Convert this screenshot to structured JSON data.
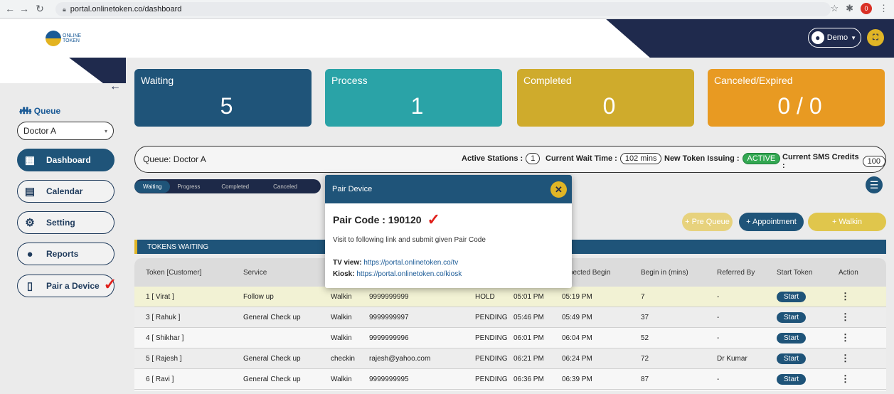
{
  "browser": {
    "url": "portal.onlinetoken.co/dashboard",
    "ext_badge": "0"
  },
  "header": {
    "logo_line1": "ONLINE",
    "logo_line2": "TOKEN",
    "user_label": "Demo"
  },
  "sidebar": {
    "queue_label": "Queue",
    "queue_selected": "Doctor A",
    "items": [
      {
        "label": "Dashboard",
        "icon": "qr-code-icon",
        "active": true
      },
      {
        "label": "Calendar",
        "icon": "calendar-icon",
        "active": false
      },
      {
        "label": "Setting",
        "icon": "gear-icon",
        "active": false
      },
      {
        "label": "Reports",
        "icon": "user-icon",
        "active": false
      },
      {
        "label": "Pair a Device",
        "icon": "tablet-icon",
        "active": false
      }
    ]
  },
  "cards": [
    {
      "title": "Waiting",
      "value": "5",
      "color": "#1f5479"
    },
    {
      "title": "Process",
      "value": "1",
      "color": "#2aa3a7"
    },
    {
      "title": "Completed",
      "value": "0",
      "color": "#cfab2c"
    },
    {
      "title": "Canceled/Expired",
      "value": "0 / 0",
      "color": "#e89a22"
    }
  ],
  "queue_bar": {
    "queue_name": "Queue: Doctor A",
    "active_stations_label": "Active Stations :",
    "active_stations_value": "1",
    "wait_time_label": "Current Wait Time :",
    "wait_time_value": "102 mins",
    "token_issuing_label": "New Token Issuing :",
    "token_issuing_value": "ACTIVE",
    "sms_label": "Current SMS Credits :",
    "sms_value": "100"
  },
  "tabs": [
    "Waiting",
    "Progress",
    "Completed",
    "Canceled"
  ],
  "actions": {
    "pre_queue": "+ Pre Queue",
    "appointment": "+ Appointment",
    "walkin": "+ Walkin"
  },
  "tokens_title": "TOKENS WAITING",
  "table": {
    "columns": [
      "Token [Customer]",
      "Service",
      "",
      "",
      "",
      "",
      "pected Begin",
      "Begin in (mins)",
      "Referred By",
      "Start Token",
      "Action"
    ],
    "rows": [
      {
        "token": "1 [ Virat ]",
        "service": "Follow up",
        "type": "Walkin",
        "contact": "9999999999",
        "status": "HOLD",
        "time": "05:01 PM",
        "expected": "05:19 PM",
        "begin_in": "7",
        "referred": "-",
        "start": "Start"
      },
      {
        "token": "3 [ Rahuk ]",
        "service": "General Check up",
        "type": "Walkin",
        "contact": "9999999997",
        "status": "PENDING",
        "time": "05:46 PM",
        "expected": "05:49 PM",
        "begin_in": "37",
        "referred": "-",
        "start": "Start"
      },
      {
        "token": "4 [ Shikhar ]",
        "service": "",
        "type": "Walkin",
        "contact": "9999999996",
        "status": "PENDING",
        "time": "06:01 PM",
        "expected": "06:04 PM",
        "begin_in": "52",
        "referred": "-",
        "start": "Start"
      },
      {
        "token": "5 [ Rajesh ]",
        "service": "General Check up",
        "type": "checkin",
        "contact": "rajesh@yahoo.com",
        "status": "PENDING",
        "time": "06:21 PM",
        "expected": "06:24 PM",
        "begin_in": "72",
        "referred": "Dr Kumar",
        "start": "Start"
      },
      {
        "token": "6 [ Ravi ]",
        "service": "General Check up",
        "type": "Walkin",
        "contact": "9999999995",
        "status": "PENDING",
        "time": "06:36 PM",
        "expected": "06:39 PM",
        "begin_in": "87",
        "referred": "-",
        "start": "Start"
      }
    ]
  },
  "modal": {
    "title": "Pair Device",
    "pair_code": "Pair Code : 190120",
    "description": "Visit to following link and submit given Pair Code",
    "tv_label": "TV view:",
    "tv_link": "https://portal.onlinetoken.co/tv",
    "kiosk_label": "Kiosk:",
    "kiosk_link": "https://portal.onlinetoken.co/kiosk"
  }
}
